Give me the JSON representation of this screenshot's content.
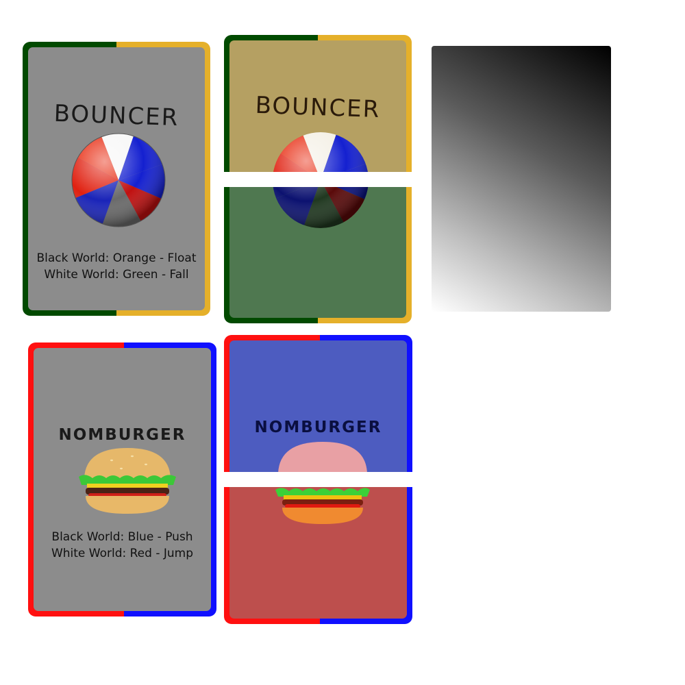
{
  "cards": {
    "bouncer_front": {
      "title": "BOUNCER",
      "rule_black": "Black World: Orange - Float",
      "rule_white": "White World: Green - Fall",
      "border_left_color": "#014a00",
      "border_right_color": "#e5b02a",
      "face_color": "#8c8c8c",
      "art": "beach-ball-icon"
    },
    "bouncer_split": {
      "title": "BOUNCER",
      "top_color": "#b5a062",
      "bottom_color": "#4f7850",
      "border_left_color": "#014a00",
      "border_right_color": "#e5b02a",
      "art": "beach-ball-icon"
    },
    "card_back": {
      "gradient_from": "#000000",
      "gradient_to": "#ffffff"
    },
    "nomburger_front": {
      "title": "NOMBURGER",
      "rule_black": "Black World: Blue - Push",
      "rule_white": "White World: Red - Jump",
      "border_left_color": "#ff1010",
      "border_right_color": "#1010ff",
      "face_color": "#8c8c8c",
      "art": "hamburger-icon"
    },
    "nomburger_split": {
      "title": "NOMBURGER",
      "top_color": "#4d5cc0",
      "bottom_color": "#bd4f4d",
      "border_left_color": "#ff1010",
      "border_right_color": "#1010ff",
      "art": "hamburger-icon"
    }
  }
}
